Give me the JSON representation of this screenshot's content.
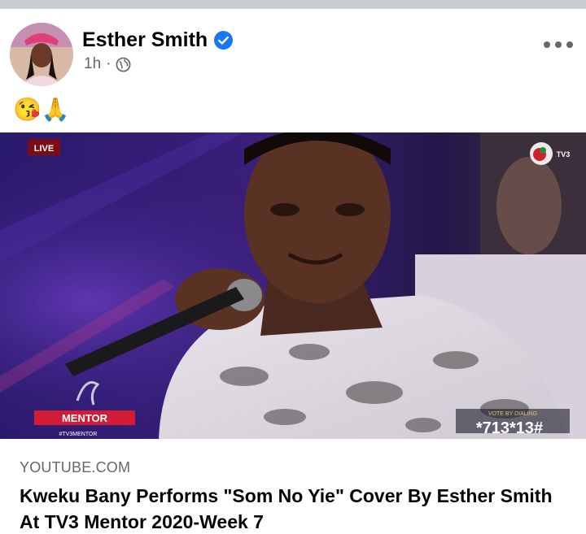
{
  "post": {
    "author": "Esther Smith",
    "time": "1h",
    "separator": "·",
    "privacy_icon": "globe-icon",
    "verified_icon": "verified-badge-icon",
    "more_icon": "more-options-icon",
    "text_emojis": "😘🙏"
  },
  "video": {
    "live_badge": "LIVE",
    "channel_logo": "TV3",
    "show_logo": "MENTOR",
    "show_handle": "#TV3MENTOR",
    "vote_label": "VOTE BY DIALING",
    "vote_code": "*713*13#"
  },
  "link_preview": {
    "domain": "YOUTUBE.COM",
    "title": "Kweku Bany Performs \"Som No Yie\" Cover By Esther Smith At TV3 Mentor 2020-Week 7"
  },
  "colors": {
    "verified": "#1877f2",
    "secondary_text": "#65676b",
    "primary_text": "#050505",
    "divider": "#c9ccd1"
  }
}
